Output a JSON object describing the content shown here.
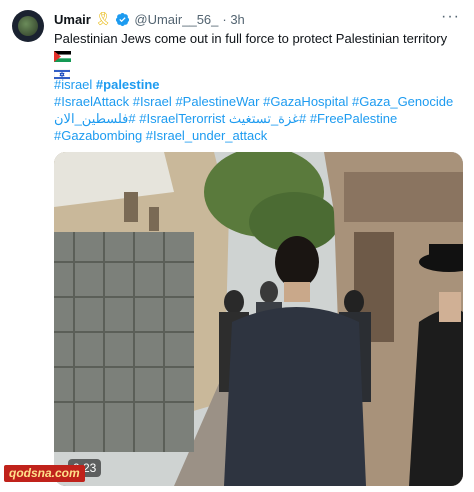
{
  "tweet": {
    "author_name": "Umair",
    "badge": "🎗",
    "handle": "@Umair__56_",
    "time": "· 3h",
    "more_label": "···",
    "text": "Palestinian Jews come out in full force to protect Palestinian territory",
    "hashtag_lines": [
      [
        "#israel",
        "#palestine"
      ],
      [
        "#IsraelAttack",
        "#Israel",
        "#PalestineWar",
        "#GazaHospital",
        "#Gaza_Genocide"
      ],
      [
        "#فلسطين_الان",
        "#IsraelTerorrist",
        "#غزة_تستغيث",
        "#FreePalestine"
      ],
      [
        "#Gazabombing",
        "#Israel_under_attack"
      ]
    ]
  },
  "video": {
    "duration": "0:23"
  },
  "watermark": {
    "prefix": "qodsna",
    "suffix": ".com"
  },
  "colors": {
    "link": "#1d9bf0",
    "text": "#0f1419",
    "secondary": "#536471"
  }
}
